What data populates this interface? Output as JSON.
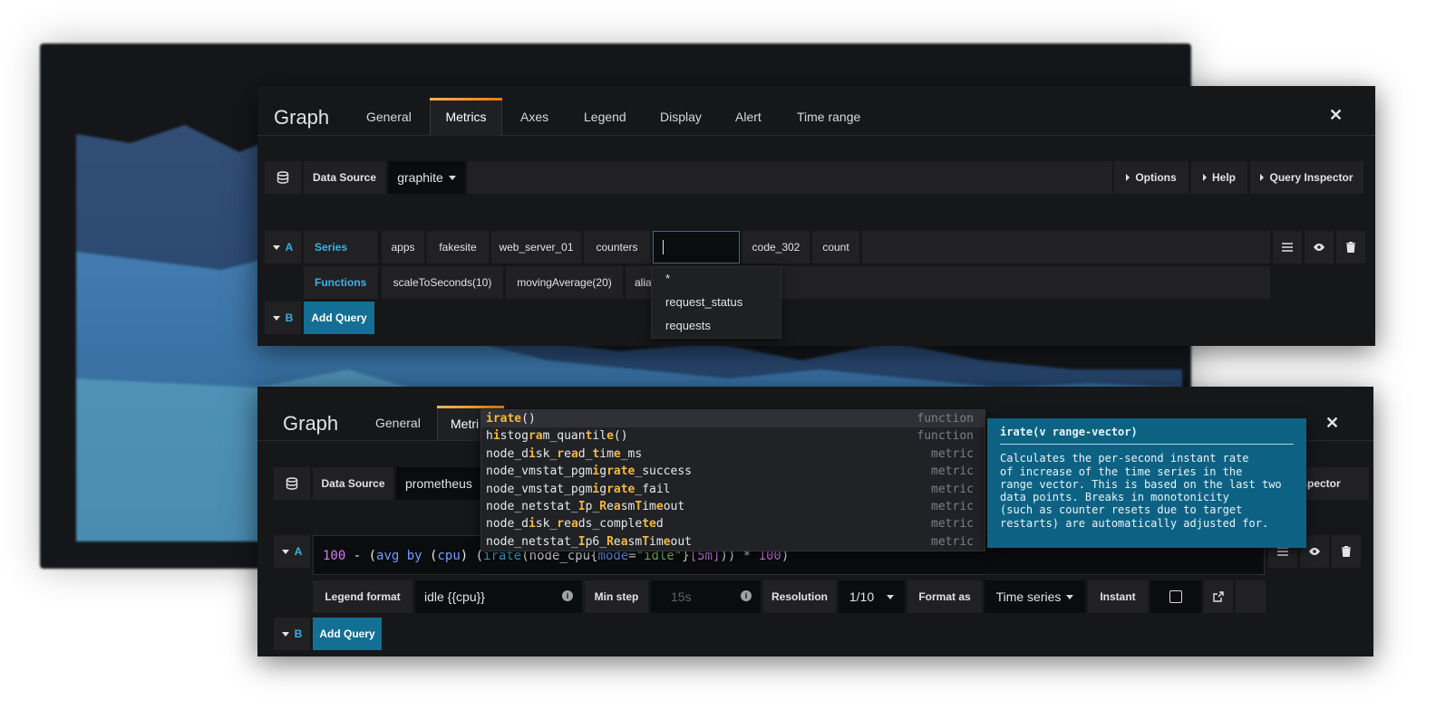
{
  "top_panel": {
    "title": "Graph",
    "tabs": [
      "General",
      "Metrics",
      "Axes",
      "Legend",
      "Display",
      "Alert",
      "Time range"
    ],
    "active_tab": "Metrics",
    "datasource_label": "Data Source",
    "datasource_value": "graphite",
    "options_label": "Options",
    "help_label": "Help",
    "query_inspector_label": "Query Inspector",
    "query_a": {
      "letter": "A",
      "series_label": "Series",
      "segments": [
        "apps",
        "fakesite",
        "web_server_01",
        "counters"
      ],
      "segments_after": [
        "code_302",
        "count"
      ],
      "functions_label": "Functions",
      "functions": [
        "scaleToSeconds(10)",
        "movingAverage(20)",
        "alia"
      ]
    },
    "query_b_letter": "B",
    "add_query_label": "Add Query",
    "dropdown_items": [
      "*",
      "request_status",
      "requests"
    ]
  },
  "bottom_panel": {
    "title": "Graph",
    "tabs": [
      "General",
      "Metri"
    ],
    "datasource_label": "Data Source",
    "datasource_value": "prometheus",
    "query_inspector_partial": "nspector",
    "query_a_letter": "A",
    "query_b_letter": "B",
    "add_query_label": "Add Query",
    "expression": {
      "p1": "100",
      "p2": " - ",
      "p3": "(",
      "p4": "avg by",
      "p5": " (",
      "p6": "cpu",
      "p7": ") (",
      "p8": "irate",
      "p9": "(",
      "p10": "node_cpu",
      "p11": "{",
      "p12": "mode",
      "p13": "=",
      "p14": "\"idle\"",
      "p15": "}",
      "p16": "[5m]",
      "p17": ")) * ",
      "p18": "100",
      "p19": ")"
    },
    "legend_format_label": "Legend format",
    "legend_format_value": "idle {{cpu}}",
    "min_step_label": "Min step",
    "min_step_placeholder": "15s",
    "resolution_label": "Resolution",
    "resolution_value": "1/10",
    "format_as_label": "Format as",
    "format_as_value": "Time series",
    "instant_label": "Instant"
  },
  "autocomplete": [
    {
      "parts": [
        {
          "t": "irate",
          "h": true
        },
        {
          "t": "()",
          "h": false
        }
      ],
      "kind": "function"
    },
    {
      "parts": [
        {
          "t": "h",
          "h": false
        },
        {
          "t": "i",
          "h": true
        },
        {
          "t": "stog",
          "h": false
        },
        {
          "t": "ra",
          "h": true
        },
        {
          "t": "m_quan",
          "h": false
        },
        {
          "t": "t",
          "h": true
        },
        {
          "t": "il",
          "h": false
        },
        {
          "t": "e",
          "h": true
        },
        {
          "t": "()",
          "h": false
        }
      ],
      "kind": "function"
    },
    {
      "parts": [
        {
          "t": "node_d",
          "h": false
        },
        {
          "t": "i",
          "h": true
        },
        {
          "t": "sk_",
          "h": false
        },
        {
          "t": "r",
          "h": true
        },
        {
          "t": "e",
          "h": false
        },
        {
          "t": "a",
          "h": true
        },
        {
          "t": "d_",
          "h": false
        },
        {
          "t": "t",
          "h": true
        },
        {
          "t": "im",
          "h": false
        },
        {
          "t": "e",
          "h": true
        },
        {
          "t": "_ms",
          "h": false
        }
      ],
      "kind": "metric"
    },
    {
      "parts": [
        {
          "t": "node_vmstat_pgm",
          "h": false
        },
        {
          "t": "i",
          "h": true
        },
        {
          "t": "g",
          "h": false
        },
        {
          "t": "rate",
          "h": true
        },
        {
          "t": "_success",
          "h": false
        }
      ],
      "kind": "metric"
    },
    {
      "parts": [
        {
          "t": "node_vmstat_pgm",
          "h": false
        },
        {
          "t": "i",
          "h": true
        },
        {
          "t": "g",
          "h": false
        },
        {
          "t": "rate",
          "h": true
        },
        {
          "t": "_fail",
          "h": false
        }
      ],
      "kind": "metric"
    },
    {
      "parts": [
        {
          "t": "node_netstat_",
          "h": false
        },
        {
          "t": "I",
          "h": true
        },
        {
          "t": "p_",
          "h": false
        },
        {
          "t": "R",
          "h": true
        },
        {
          "t": "e",
          "h": false
        },
        {
          "t": "a",
          "h": true
        },
        {
          "t": "sm",
          "h": false
        },
        {
          "t": "T",
          "h": true
        },
        {
          "t": "im",
          "h": false
        },
        {
          "t": "e",
          "h": true
        },
        {
          "t": "out",
          "h": false
        }
      ],
      "kind": "metric"
    },
    {
      "parts": [
        {
          "t": "node_d",
          "h": false
        },
        {
          "t": "i",
          "h": true
        },
        {
          "t": "sk_",
          "h": false
        },
        {
          "t": "r",
          "h": true
        },
        {
          "t": "e",
          "h": false
        },
        {
          "t": "a",
          "h": true
        },
        {
          "t": "ds_comple",
          "h": false
        },
        {
          "t": "te",
          "h": true
        },
        {
          "t": "d",
          "h": false
        }
      ],
      "kind": "metric"
    },
    {
      "parts": [
        {
          "t": "node_netstat_",
          "h": false
        },
        {
          "t": "I",
          "h": true
        },
        {
          "t": "p6_",
          "h": false
        },
        {
          "t": "R",
          "h": true
        },
        {
          "t": "e",
          "h": false
        },
        {
          "t": "a",
          "h": true
        },
        {
          "t": "sm",
          "h": false
        },
        {
          "t": "T",
          "h": true
        },
        {
          "t": "im",
          "h": false
        },
        {
          "t": "e",
          "h": true
        },
        {
          "t": "out",
          "h": false
        }
      ],
      "kind": "metric"
    }
  ],
  "doc": {
    "title": "irate(v range-vector)",
    "lines": [
      "Calculates the per-second instant rate",
      "of increase of the time series in the",
      "range vector. This is based on the last two",
      "data points. Breaks in monotonicity",
      "(such as counter resets due to target",
      "restarts) are automatically adjusted for."
    ]
  },
  "colors": {
    "accent_orange": "#eb7b18",
    "primary_button": "#136f93",
    "doc_background": "#0d6284",
    "query_blue": "#33b5e5",
    "highlight": "#f5b73b"
  }
}
